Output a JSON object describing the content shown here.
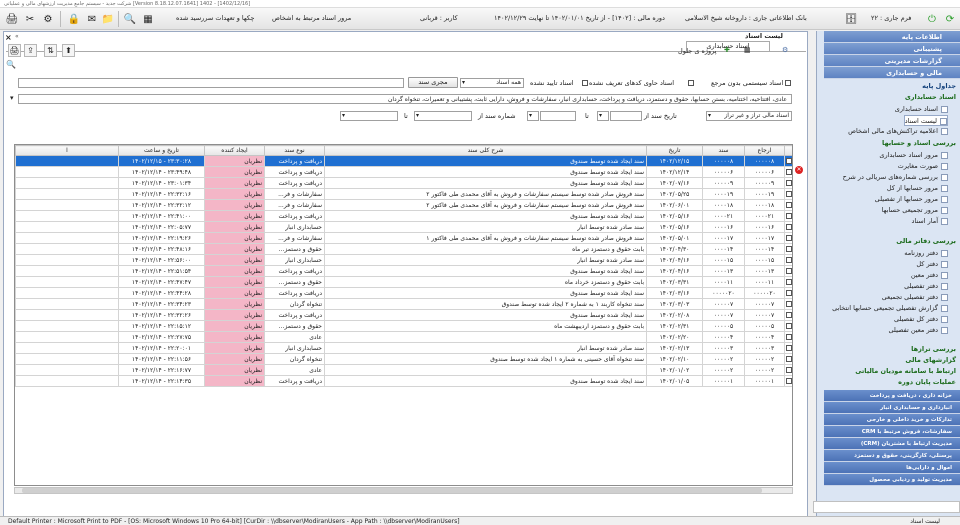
{
  "window": {
    "title": "شرکت جدید - سیستم جامع مدیریت ارزشهای مالی و عملیاتی [Version 8.18.12.07.1641] 1402 - [1402/12/16]"
  },
  "toolbar": {
    "fiscal_year_label": "فرم جاری : ۲۲",
    "system_name": "بانک اطلاعاتی جاری : داروخانه شیخ الاسلامی",
    "fiscal_period": "دوره مالی : [۱۴۰۲] - از تاریخ ۱۴۰۲/۰۱/۰۱ تا نهایت ۱۴۰۲/۱۲/۲۹",
    "user": "کاربر : قربانی",
    "related_docs": "مرور اسناد مرتبط به اشخاص",
    "checks": "چکها و تعهدات سررسید شده"
  },
  "document": {
    "title": "لیست اسناد",
    "subtab": "اسناد حسابداری",
    "custom_columns": "پروژه ی جلول",
    "close": "×",
    "collapse": "«"
  },
  "filters": {
    "system_docs_without_ref": "اسناد سیستمی بدون مرجع",
    "docs_with_undefined_codes": "اسناد حاوی کدهای تعریف نشده",
    "unapproved_docs": "اسناد تایید نشده",
    "type_select": "همه اسناد",
    "apply_button": "مجری سند",
    "doc_types_text": "عادی، افتتاحیه، اختتامیه، بستن حسابها، حقوق و دستمزد، دریافت و پرداخت، حسابداری انبار، سفارشات و فروش، دارایی ثابت، پشتیبانی و تعمیرات، تنخواه گردان",
    "balanced_select": "اسناد مالی تراز و غیر تراز",
    "date_from_label": "تاریخ سند از",
    "to_label": "تا",
    "doc_number_from_label": "شماره سند از",
    "to_label2": "تا"
  },
  "grid": {
    "columns": [
      "",
      "ارجاع",
      "سند",
      "تاریخ",
      "شرح کلی سند",
      "نوع سند",
      "ایجاد کننده",
      "تاریخ و ساعت",
      "ا"
    ],
    "rows": [
      {
        "ref": "۰۰۰۰۰۸",
        "doc": "۰۰۰۰۰۸",
        "date": "۱۴۰۲/۱۲/۱۵",
        "desc": "سند ایجاد شده توسط صندوق",
        "type": "دریافت و پرداخت",
        "creator": "نظریان",
        "dt": "۱۴۰۲/۱۲/۱۵ - ۲۳:۳۰:۲۸",
        "selected": true
      },
      {
        "ref": "۰۰۰۰۰۶",
        "doc": "۰۰۰۰۰۶",
        "date": "۱۴۰۲/۱۲/۱۴",
        "desc": "سند ایجاد شده توسط صندوق",
        "type": "دریافت و پرداخت",
        "creator": "نظریان",
        "dt": "۱۴۰۲/۱۲/۱۴ - ۲۳:۴۹:۴۸",
        "selected": false
      },
      {
        "ref": "۰۰۰۰۰۹",
        "doc": "۰۰۰۰۰۹",
        "date": "۱۴۰۲/۰۷/۱۶",
        "desc": "سند ایجاد شده توسط صندوق",
        "type": "دریافت و پرداخت",
        "creator": "نظریان",
        "dt": "۱۴۰۲/۱۲/۱۴ - ۲۳:۰۱:۳۴",
        "selected": false
      },
      {
        "ref": "۰۰۰۰۱۹",
        "doc": "۰۰۰۰۱۹",
        "date": "۱۴۰۲/۰۵/۲۵",
        "desc": "سند فروش صادر شده توسط سیستم سفارشات و فروش به آقای محمدی طی فاکتور ۲",
        "type": "سفارشات و فر...",
        "creator": "نظریان",
        "dt": "۱۴۰۲/۱۲/۱۴ - ۲۲:۳۲:۱۶",
        "selected": false
      },
      {
        "ref": "۰۰۰۰۱۸",
        "doc": "۰۰۰۰۱۸",
        "date": "۱۴۰۲/۰۶/۰۱",
        "desc": "سند فروش صادر شده توسط سیستم سفارشات و فروش به آقای محمدی طی فاکتور ۲",
        "type": "سفارشات و فر...",
        "creator": "نظریان",
        "dt": "۱۴۰۲/۱۲/۱۴ - ۲۲:۳۲:۱۲",
        "selected": false
      },
      {
        "ref": "۰۰۰۰۲۱",
        "doc": "۰۰۰۰۲۱",
        "date": "۱۴۰۲/۰۵/۱۶",
        "desc": "سند ایجاد شده توسط صندوق",
        "type": "دریافت و پرداخت",
        "creator": "نظریان",
        "dt": "۱۴۰۲/۱۲/۱۴ - ۲۲:۴۱:۰۰",
        "selected": false
      },
      {
        "ref": "۰۰۰۰۱۶",
        "doc": "۰۰۰۰۱۶",
        "date": "۱۴۰۲/۰۵/۱۶",
        "desc": "سند صادر شده توسط انبار",
        "type": "حسابداری انبار",
        "creator": "نظریان",
        "dt": "۱۴۰۲/۱۲/۱۴ - ۲۲:۰۵:۷۷",
        "selected": false
      },
      {
        "ref": "۰۰۰۰۱۷",
        "doc": "۰۰۰۰۱۷",
        "date": "۱۴۰۲/۰۵/۰۱",
        "desc": "سند فروش صادر شده توسط سیستم سفارشات و فروش به آقای محمدی طی فاکتور ۱",
        "type": "سفارشات و فر...",
        "creator": "نظریان",
        "dt": "۱۴۰۲/۱۲/۱۴ - ۲۲:۱۹:۲۶",
        "selected": false
      },
      {
        "ref": "۰۰۰۰۱۴",
        "doc": "۰۰۰۰۱۴",
        "date": "۱۴۰۲/۰۴/۳۰",
        "desc": "بابت حقوق و دستمزد  تیر ماه",
        "type": "حقوق و دستمز...",
        "creator": "نظریان",
        "dt": "۱۴۰۲/۱۲/۱۴ - ۲۲:۴۸:۱۶",
        "selected": false
      },
      {
        "ref": "۰۰۰۰۱۵",
        "doc": "۰۰۰۰۱۵",
        "date": "۱۴۰۲/۰۴/۱۶",
        "desc": "سند صادر شده توسط انبار",
        "type": "حسابداری انبار",
        "creator": "نظریان",
        "dt": "۱۴۰۲/۱۲/۱۴ - ۲۲:۵۶:۰۰",
        "selected": false
      },
      {
        "ref": "۰۰۰۰۱۳",
        "doc": "۰۰۰۰۱۳",
        "date": "۱۴۰۲/۰۴/۱۶",
        "desc": "سند ایجاد شده توسط صندوق",
        "type": "دریافت و پرداخت",
        "creator": "نظریان",
        "dt": "۱۴۰۲/۱۲/۱۴ - ۲۲:۵۱:۵۴",
        "selected": false
      },
      {
        "ref": "۰۰۰۰۱۱",
        "doc": "۰۰۰۰۱۱",
        "date": "۱۴۰۲/۰۳/۳۱",
        "desc": "بابت حقوق و دستمزد  خرداد ماه",
        "type": "حقوق و دستمز...",
        "creator": "نظریان",
        "dt": "۱۴۰۲/۱۲/۱۴ - ۲۲:۴۷:۴۷",
        "selected": false
      },
      {
        "ref": "۰۰۰۰۰۲۰",
        "doc": "۰۰۰۰۰۲۰",
        "date": "۱۴۰۲/۰۳/۱۶",
        "desc": "سند ایجاد شده توسط صندوق",
        "type": "دریافت و پرداخت",
        "creator": "نظریان",
        "dt": "۱۴۰۲/۱۲/۱۴ - ۲۲:۴۴:۲۸",
        "selected": false
      },
      {
        "ref": "۰۰۰۰۰۷",
        "doc": "۰۰۰۰۰۷",
        "date": "۱۴۰۲/۰۳/۰۳",
        "desc": "سند تنخواه کاربند ۱ به شماره ۲ ایجاد شده توسط صندوق",
        "type": "تنخواه گردان",
        "creator": "نظریان",
        "dt": "۱۴۰۲/۱۲/۱۴ - ۲۲:۳۴:۲۳",
        "selected": false
      },
      {
        "ref": "۰۰۰۰۰۷",
        "doc": "۰۰۰۰۰۷",
        "date": "۱۴۰۲/۰۲/۰۸",
        "desc": "سند ایجاد شده توسط صندوق",
        "type": "دریافت و پرداخت",
        "creator": "نظریان",
        "dt": "۱۴۰۲/۱۲/۱۴ - ۲۲:۳۲:۲۶",
        "selected": false
      },
      {
        "ref": "۰۰۰۰۰۵",
        "doc": "۰۰۰۰۰۵",
        "date": "۱۴۰۲/۰۲/۳۱",
        "desc": "بابت حقوق و دستمزد  اردیبهشت ماه",
        "type": "حقوق و دستمز...",
        "creator": "نظریان",
        "dt": "۱۴۰۲/۱۲/۱۴ - ۲۲:۱۵:۱۲",
        "selected": false
      },
      {
        "ref": "۰۰۰۰۰۴",
        "doc": "۰۰۰۰۰۴",
        "date": "۱۴۰۲/۰۲/۲۰",
        "desc": "",
        "type": "عادی",
        "creator": "نظریان",
        "dt": "۱۴۰۲/۱۲/۱۴ - ۲۲:۲۷:۷۵",
        "selected": false
      },
      {
        "ref": "۰۰۰۰۰۳",
        "doc": "۰۰۰۰۰۳",
        "date": "۱۴۰۲/۰۲/۱۳",
        "desc": "سند صادر شده توسط انبار",
        "type": "حسابداری انبار",
        "creator": "نظریان",
        "dt": "۱۴۰۲/۱۲/۱۴ - ۲۲:۲۰:۰۱",
        "selected": false
      },
      {
        "ref": "۰۰۰۰۰۲",
        "doc": "۰۰۰۰۰۲",
        "date": "۱۴۰۲/۰۲/۱۰",
        "desc": "سند تنخواه آقای حسینی به شماره ۱ ایجاد شده توسط صندوق",
        "type": "تنخواه گردان",
        "creator": "نظریان",
        "dt": "۱۴۰۲/۱۲/۱۴ - ۲۲:۱۱:۵۶",
        "selected": false
      },
      {
        "ref": "۰۰۰۰۰۲",
        "doc": "۰۰۰۰۰۲",
        "date": "۱۴۰۲/۰۱/۰۲",
        "desc": "",
        "type": "عادی",
        "creator": "نظریان",
        "dt": "۱۴۰۲/۱۲/۱۴ - ۲۲:۱۶:۷۷",
        "selected": false
      },
      {
        "ref": "۰۰۰۰۰۱",
        "doc": "۰۰۰۰۰۱",
        "date": "۱۴۰۲/۰۱/۰۵",
        "desc": "سند ایجاد شده توسط صندوق",
        "type": "دریافت و پرداخت",
        "creator": "نظریان",
        "dt": "۱۴۰۲/۱۲/۱۴ - ۲۲:۱۴:۳۵",
        "selected": false
      }
    ]
  },
  "nav": {
    "top_items": [
      "اطلاعات پایه",
      "پشتیبانی",
      "گزارشات مدیریتی",
      "مالی و حسابداری"
    ],
    "sec_base": "جداول پایه",
    "sec_accounting_docs": "اسناد حسابداری",
    "items_docs": [
      "اسناد حسابداری",
      "لیست اسناد",
      "اعلامیه تراکنش‌های مالی اشخاص"
    ],
    "sec_review": "بررسی اسناد و حسابها",
    "items_review": [
      "مرور اسناد حسابداری",
      "صورت مغایرت",
      "بررسی شماره‌های سریالی در شرح",
      "مرور حسابها از کل",
      "مرور حسابها از تفصیلی",
      "مرور تجمیعی حسابها",
      "آمار اسناد"
    ],
    "sec_ledgers": "بررسی دفاتر مالی",
    "items_ledgers": [
      "دفتر روزنامه",
      "دفتر کل",
      "دفتر معین",
      "دفتر تفصیلی",
      "دفتر تفصیلی تجمیعی",
      "گزارش تفصیلی تجمیعی حسابها انتخابی",
      "دفتر کل تفصیلی",
      "دفتر معین تفصیلی"
    ],
    "sec_balances": "بررسی ترازها",
    "sec_fin_reports": "گزارشهای مالی",
    "sec_link": "ارتباط با سامانه مودیان مالیاتی",
    "sec_ops": "عملیات پایان دوره",
    "bottom_items": [
      "خزانه داری ، دریافت و پرداخت",
      "انبارداری و حسابداری انبار",
      "تدارکات و خرید داخلی و خارجی",
      "سفارشات، فروش مرتبط با CRM",
      "مدیریت ارتباط با مشتریان (CRM)",
      "پرسنلی، کارگزینی، حقوق و دستمزد",
      "اموال و دارایی‌ها",
      "مدیریت تولید و ردیابی محصول"
    ]
  },
  "status": {
    "left": "Default Printer : Microsoft Print to PDF - [OS: Microsoft Windows 10 Pro 64-bit]  [CurDir : \\\\dbserver\\ModiranUsers - App Path : \\\\dbserver\\ModiranUsers]",
    "right": "لیست اسناد"
  }
}
